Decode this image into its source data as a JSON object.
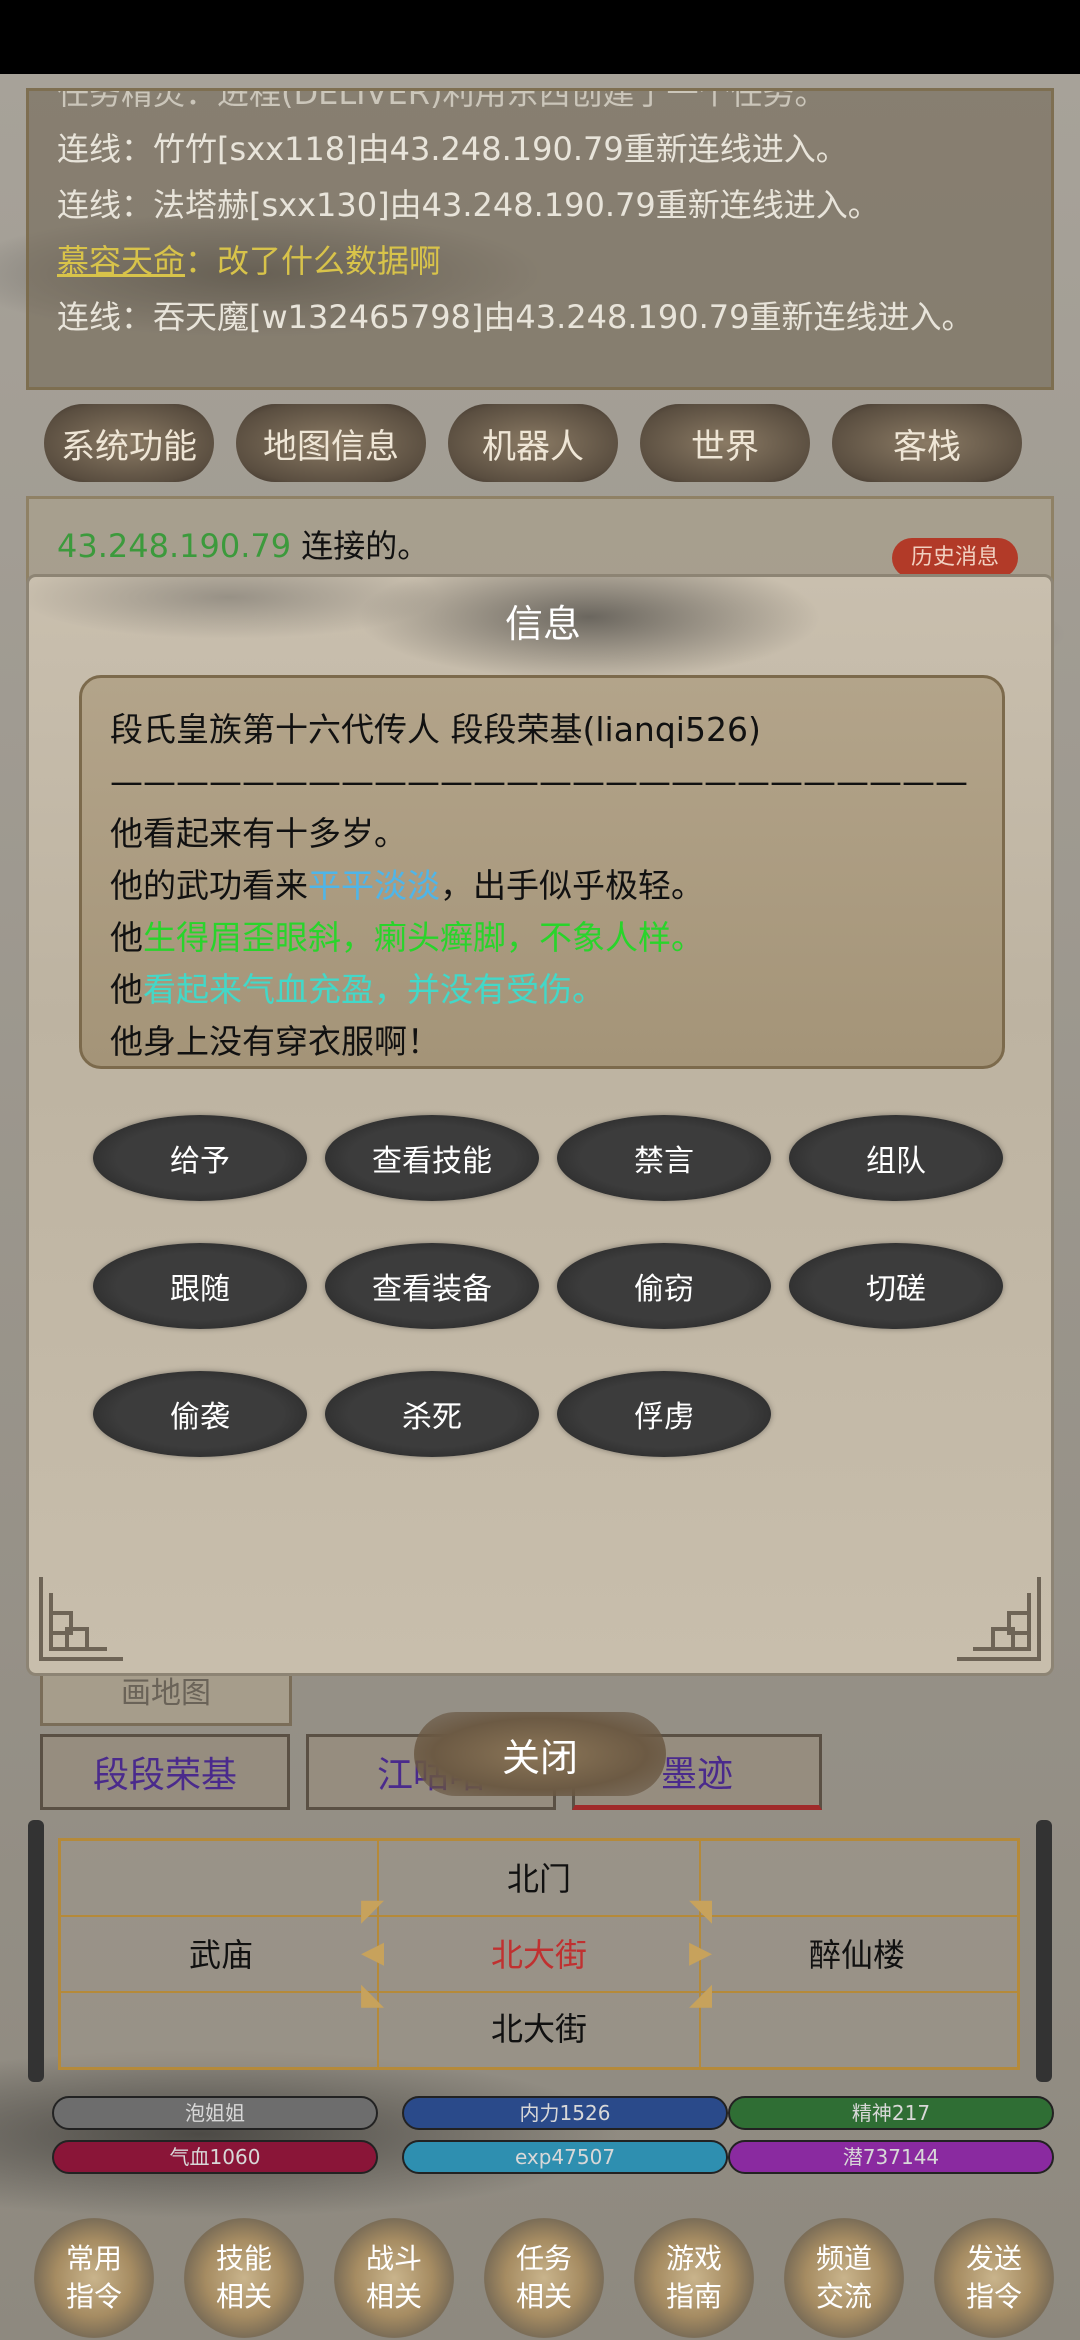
{
  "chat": {
    "cut_line": "任务精灵：进程(DELIVER)利用东西创建了一个任务。",
    "lines": [
      {
        "prefix": "连线：",
        "text": "竹竹[sxx118]由43.248.190.79重新连线进入。"
      },
      {
        "prefix": "连线：",
        "text": "法塔赫[sxx130]由43.248.190.79重新连线进入。"
      },
      {
        "prefix": "慕容天命",
        "text": "：改了什么数据啊"
      },
      {
        "prefix": "连线：",
        "text": "吞天魔[w132465798]由43.248.190.79重新连线进入。"
      }
    ]
  },
  "tabs": [
    "系统功能",
    "地图信息",
    "机器人",
    "世界",
    "客栈"
  ],
  "status": {
    "ip": "43.248.190.79",
    "text": " 连接的。",
    "history_badge": "历史消息"
  },
  "modal": {
    "title": "信息",
    "info": {
      "line1": "段氏皇族第十六代传人 段段荣基(lianqi526)",
      "divider": "——————————————————————————",
      "line2": "他看起来有十多岁。",
      "line3a": "他的武功看来",
      "line3b": "平平淡淡",
      "line3c": "，出手似乎极轻。",
      "line4a": "他",
      "line4b": "生得眉歪眼斜，瘌头癣脚，不象人样。",
      "line5a": "他",
      "line5b": "看起来气血充盈，并没有受伤。",
      "line6": "他身上没有穿衣服啊！"
    },
    "actions": [
      "给予",
      "查看技能",
      "禁言",
      "组队",
      "跟随",
      "查看装备",
      "偷窃",
      "切磋",
      "偷袭",
      "杀死",
      "俘虏"
    ]
  },
  "below": {
    "tag": "画地图",
    "names": [
      "段段荣基",
      "江咕咕",
      "墨迹"
    ],
    "close": "关闭"
  },
  "map": {
    "north": "北门",
    "west": "武庙",
    "current": "北大街",
    "east": "醉仙楼",
    "south": "北大街"
  },
  "stats": {
    "name": "泡姐姐",
    "neili": "内力1526",
    "jingshen": "精神217",
    "qixue": "气血1060",
    "exp": "exp47507",
    "qian": "潜737144",
    "colors": {
      "name": "#6d6d6d",
      "neili": "#2a4a8a",
      "jingshen": "#2f6e34",
      "qixue": "#8a1538",
      "exp": "#2e8fb0",
      "qian": "#8a2aa0"
    }
  },
  "nav": [
    {
      "top": "常用",
      "bottom": "指令"
    },
    {
      "top": "技能",
      "bottom": "相关"
    },
    {
      "top": "战斗",
      "bottom": "相关"
    },
    {
      "top": "任务",
      "bottom": "相关"
    },
    {
      "top": "游戏",
      "bottom": "指南"
    },
    {
      "top": "频道",
      "bottom": "交流"
    },
    {
      "top": "发送",
      "bottom": "指令"
    }
  ]
}
